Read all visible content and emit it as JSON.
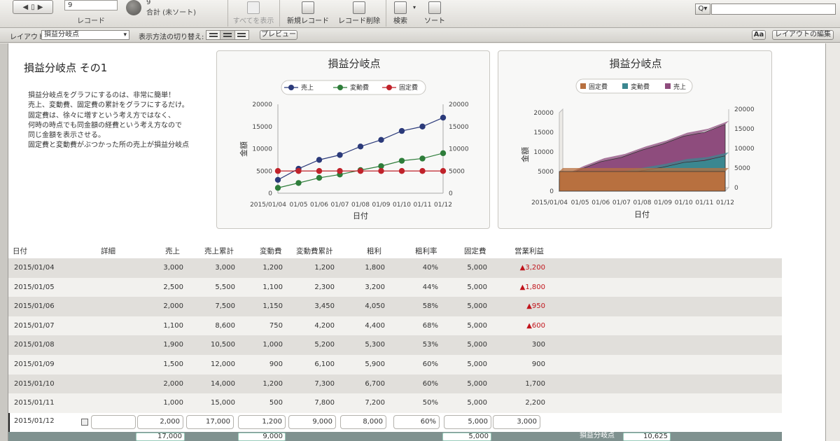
{
  "toolbar": {
    "record_value": "9",
    "record_label": "レコード",
    "total_count": "9",
    "total_label": "合計 (未ソート)",
    "show_all": "すべてを表示",
    "new_record": "新規レコード",
    "delete_record": "レコード削除",
    "find": "検索",
    "sort": "ソート",
    "quick_find_icon": "Q▾"
  },
  "layoutbar": {
    "layout_label": "レイアウト:",
    "layout_value": "損益分岐点",
    "view_as_label": "表示方法の切り替え:",
    "preview": "プレビュー",
    "format_button": "Aa",
    "edit_layout": "レイアウトの編集"
  },
  "page": {
    "title": "損益分岐点 その1",
    "description": [
      "損益分岐点をグラフにするのは、非常に簡単！",
      "売上、変動費、固定費の累計をグラフにするだけ。",
      "固定費は、徐々に増すという考え方ではなく、",
      "何時の時点でも同金額の経費という考え方なので",
      "同じ金額を表示させる。",
      "固定費と変動費がぶつかった所の売上が損益分岐点"
    ]
  },
  "chart_data": [
    {
      "type": "line",
      "title": "損益分岐点",
      "xlabel": "日付",
      "ylabel": "金額",
      "ylim": [
        0,
        20000
      ],
      "yticks": [
        0,
        5000,
        10000,
        15000,
        20000
      ],
      "x": [
        "2015/01/04",
        "2015/01/05",
        "2015/01/06",
        "2015/01/07",
        "2015/01/08",
        "2015/01/09",
        "2015/01/10",
        "2015/01/11",
        "2015/01/12"
      ],
      "x_tick_labels": [
        "2015/01/04",
        "01/05",
        "01/06",
        "01/07",
        "01/08",
        "01/09",
        "01/10",
        "01/11",
        "01/12"
      ],
      "series": [
        {
          "name": "売上",
          "color": "#2b3a7a",
          "values": [
            3000,
            5500,
            7500,
            8600,
            10500,
            12000,
            14000,
            15000,
            17000
          ]
        },
        {
          "name": "変動費",
          "color": "#2e7d3a",
          "values": [
            1200,
            2300,
            3450,
            4200,
            5200,
            6100,
            7300,
            7800,
            9000
          ]
        },
        {
          "name": "固定費",
          "color": "#c0222a",
          "values": [
            5000,
            5000,
            5000,
            5000,
            5000,
            5000,
            5000,
            5000,
            5000
          ]
        }
      ],
      "legend": "top",
      "grid": false
    },
    {
      "type": "area",
      "title": "損益分岐点",
      "xlabel": "日付",
      "ylabel": "金額",
      "ylim": [
        0,
        20000
      ],
      "yticks": [
        0,
        5000,
        10000,
        15000,
        20000
      ],
      "x": [
        "2015/01/04",
        "2015/01/05",
        "2015/01/06",
        "2015/01/07",
        "2015/01/08",
        "2015/01/09",
        "2015/01/10",
        "2015/01/11",
        "2015/01/12"
      ],
      "x_tick_labels": [
        "2015/01/04",
        "01/05",
        "01/06",
        "01/07",
        "01/08",
        "01/09",
        "01/10",
        "01/11",
        "01/12"
      ],
      "series": [
        {
          "name": "固定費",
          "color": "#b8703f",
          "values": [
            5000,
            5000,
            5000,
            5000,
            5000,
            5000,
            5000,
            5000,
            5000
          ]
        },
        {
          "name": "変動費",
          "color": "#3b8790",
          "values": [
            1200,
            2300,
            3450,
            4200,
            5200,
            6100,
            7300,
            7800,
            9000
          ]
        },
        {
          "name": "売上",
          "color": "#8e4c7d",
          "values": [
            3000,
            5500,
            7500,
            8600,
            10500,
            12000,
            14000,
            15000,
            17000
          ]
        }
      ],
      "legend": "top",
      "style": "3d"
    }
  ],
  "table": {
    "headers": [
      "日付",
      "詳細",
      "売上",
      "売上累計",
      "変動費",
      "変動費累計",
      "粗利",
      "粗利率",
      "固定費",
      "営業利益"
    ],
    "rows": [
      [
        "2015/01/04",
        "",
        "3,000",
        "3,000",
        "1,200",
        "1,200",
        "1,800",
        "40%",
        "5,000",
        "▲3,200"
      ],
      [
        "2015/01/05",
        "",
        "2,500",
        "5,500",
        "1,100",
        "2,300",
        "3,200",
        "44%",
        "5,000",
        "▲1,800"
      ],
      [
        "2015/01/06",
        "",
        "2,000",
        "7,500",
        "1,150",
        "3,450",
        "4,050",
        "58%",
        "5,000",
        "▲950"
      ],
      [
        "2015/01/07",
        "",
        "1,100",
        "8,600",
        "750",
        "4,200",
        "4,400",
        "68%",
        "5,000",
        "▲600"
      ],
      [
        "2015/01/08",
        "",
        "1,900",
        "10,500",
        "1,000",
        "5,200",
        "5,300",
        "53%",
        "5,000",
        "300"
      ],
      [
        "2015/01/09",
        "",
        "1,500",
        "12,000",
        "900",
        "6,100",
        "5,900",
        "60%",
        "5,000",
        "900"
      ],
      [
        "2015/01/10",
        "",
        "2,000",
        "14,000",
        "1,200",
        "7,300",
        "6,700",
        "60%",
        "5,000",
        "1,700"
      ],
      [
        "2015/01/11",
        "",
        "1,000",
        "15,000",
        "500",
        "7,800",
        "7,200",
        "50%",
        "5,000",
        "2,200"
      ],
      [
        "2015/01/12",
        "",
        "2,000",
        "17,000",
        "1,200",
        "9,000",
        "8,000",
        "60%",
        "5,000",
        "3,000"
      ]
    ],
    "summary": {
      "sales_total": "17,000",
      "variable_total": "9,000",
      "fixed": "5,000",
      "bep_label": "損益分岐点",
      "bep_value": "10,625"
    }
  }
}
